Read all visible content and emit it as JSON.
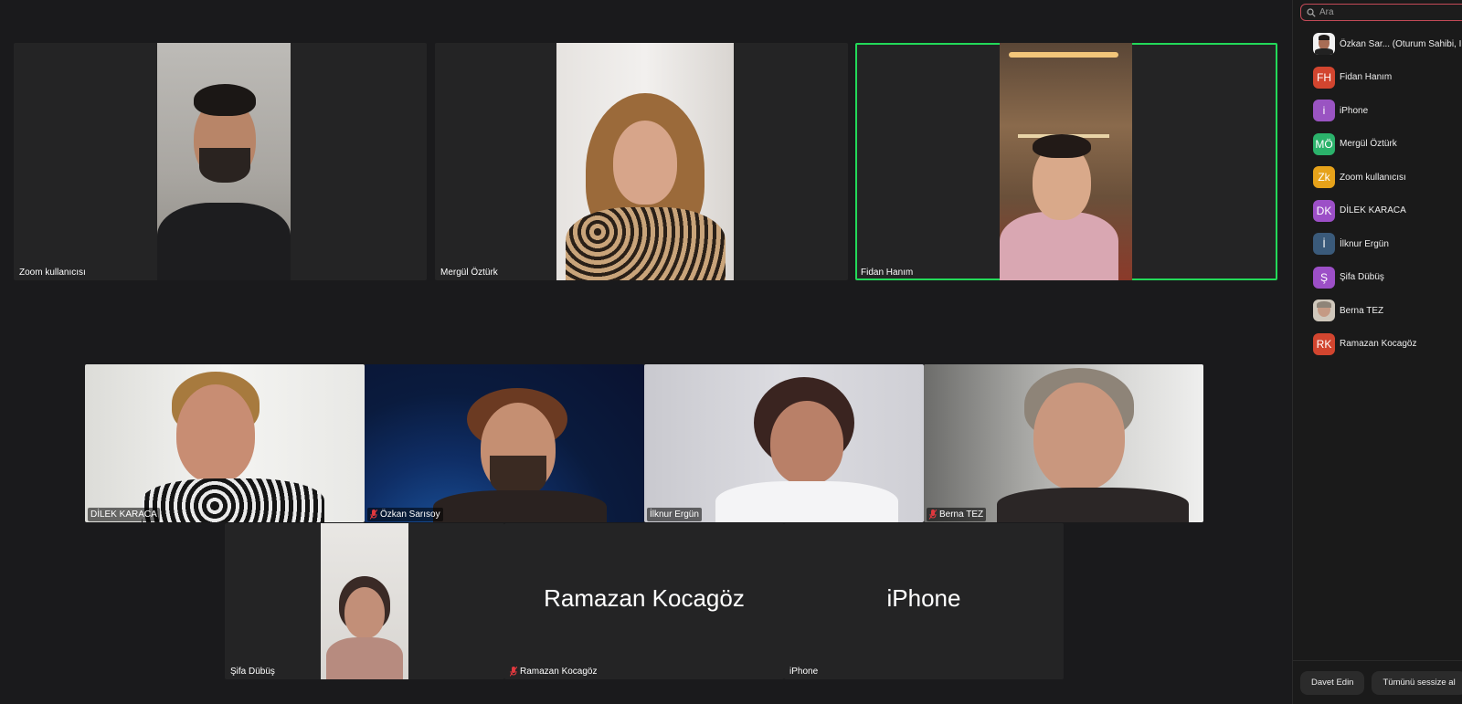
{
  "search": {
    "placeholder": "Ara"
  },
  "top_tiles": [
    {
      "name": "Zoom kullanıcısı"
    },
    {
      "name": "Mergül Öztürk"
    },
    {
      "name": "Fidan Hanım"
    }
  ],
  "middle_tiles": [
    {
      "name": "DİLEK KARACA",
      "muted": false
    },
    {
      "name": "Özkan Sarısoy",
      "muted": true
    },
    {
      "name": "İlknur Ergün",
      "muted": false
    },
    {
      "name": "Berna TEZ",
      "muted": true
    }
  ],
  "bottom_tiles": [
    {
      "name": "Şifa Dübüş",
      "big_name": ""
    },
    {
      "name": "Ramazan Kocagöz",
      "big_name": "Ramazan Kocagöz",
      "muted": true
    },
    {
      "name": "iPhone",
      "big_name": "iPhone"
    }
  ],
  "participants": [
    {
      "initials": "",
      "name": "Özkan Sar... (Oturum Sahibi, I",
      "color": "#ffffff",
      "photo": true
    },
    {
      "initials": "FH",
      "name": "Fidan Hanım",
      "color": "#d2452f"
    },
    {
      "initials": "i",
      "name": "iPhone",
      "color": "#9a54c2"
    },
    {
      "initials": "MÖ",
      "name": "Mergül Öztürk",
      "color": "#2bb26b"
    },
    {
      "initials": "Zk",
      "name": "Zoom kullanıcısı",
      "color": "#e6a21a"
    },
    {
      "initials": "DK",
      "name": "DİLEK KARACA",
      "color": "#9c4fc7"
    },
    {
      "initials": "İ",
      "name": "İlknur Ergün",
      "color": "#3a5a7a"
    },
    {
      "initials": "Ş",
      "name": "Şifa Dübüş",
      "color": "#9c4fc7"
    },
    {
      "initials": "",
      "name": "Berna TEZ",
      "color": "#b9a48a",
      "photo": true
    },
    {
      "initials": "RK",
      "name": "Ramazan Kocagöz",
      "color": "#d2452f"
    }
  ],
  "footer": {
    "invite_label": "Davet Edin",
    "mute_all_label": "Tümünü sessize al"
  },
  "colors": {
    "active_speaker": "#23d959",
    "search_border": "#c24a57",
    "muted_mic": "#e0383e"
  }
}
